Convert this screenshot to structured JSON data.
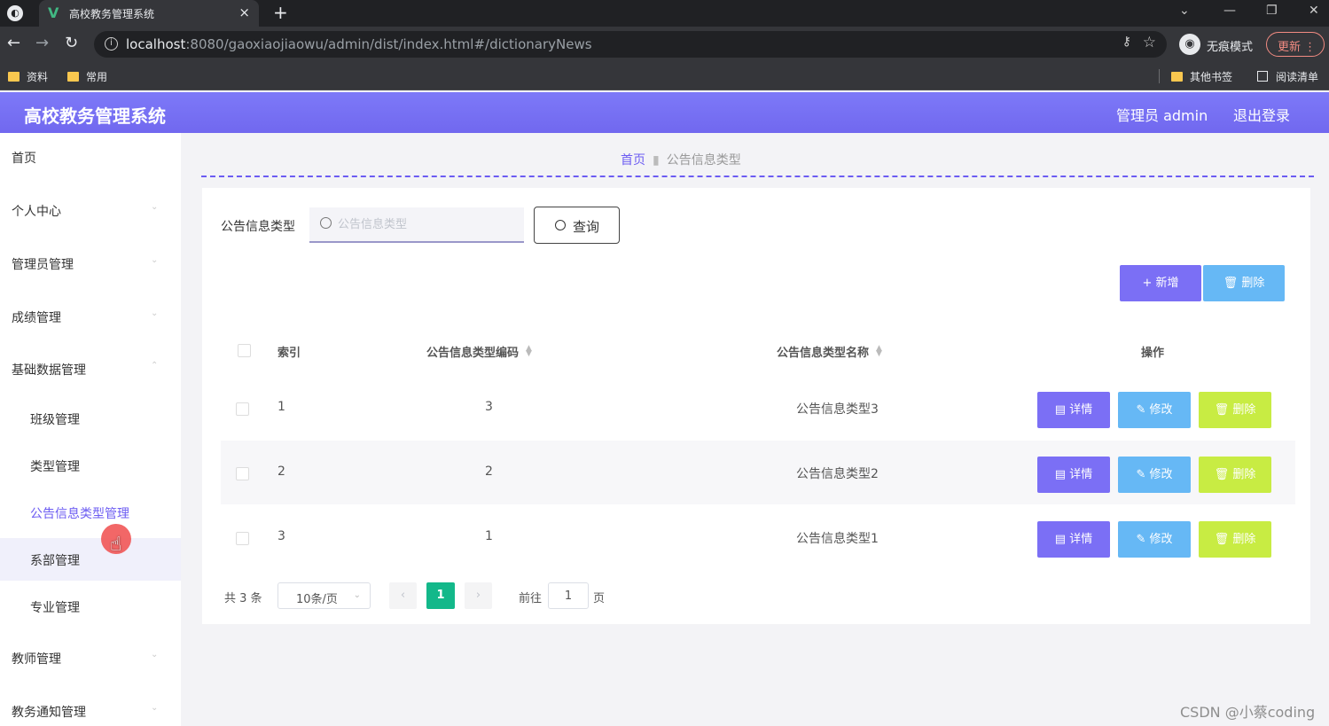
{
  "browser": {
    "tab_title": "高校教务管理系统",
    "tab_close": "×",
    "new_tab": "+",
    "url_host": "localhost",
    "url_rest": ":8080/gaoxiaojiaowu/admin/dist/index.html#/dictionaryNews",
    "incognito_label": "无痕模式",
    "update_label": "更新",
    "bookmarks": [
      "资料",
      "常用"
    ],
    "other_bookmarks": "其他书签",
    "reading_list": "阅读清单"
  },
  "header": {
    "title": "高校教务管理系统",
    "admin_text": "管理员 admin",
    "logout": "退出登录"
  },
  "sidebar": {
    "menus": [
      "首页",
      "个人中心",
      "管理员管理",
      "成绩管理",
      "基础数据管理"
    ],
    "submenus": [
      "班级管理",
      "类型管理",
      "公告信息类型管理",
      "系部管理",
      "专业管理"
    ],
    "menus_after": [
      "教师管理",
      "教务通知管理"
    ]
  },
  "breadcrumb": {
    "home": "首页",
    "current": "公告信息类型"
  },
  "search": {
    "label": "公告信息类型",
    "placeholder": "公告信息类型",
    "value": "",
    "query_button": "查询"
  },
  "actions": {
    "add": "+ 新增",
    "batch_delete": "删除"
  },
  "table": {
    "headers": {
      "index": "索引",
      "code": "公告信息类型编码",
      "name": "公告信息类型名称",
      "ops": "操作"
    },
    "rows": [
      {
        "index": "1",
        "code": "3",
        "name": "公告信息类型3"
      },
      {
        "index": "2",
        "code": "2",
        "name": "公告信息类型2"
      },
      {
        "index": "3",
        "code": "1",
        "name": "公告信息类型1"
      }
    ],
    "row_buttons": {
      "detail": "详情",
      "edit": "修改",
      "delete": "删除"
    }
  },
  "pagination": {
    "total": "共 3 条",
    "page_size": "10条/页",
    "current_page": "1",
    "goto_label": "前往",
    "goto_value": "1",
    "page_suffix": "页"
  },
  "watermark": "CSDN @小蔡coding",
  "colors": {
    "header": "#7168ef",
    "accent": "#6c5cf2",
    "btn_primary": "#7b6ff5",
    "btn_info": "#66b8f5",
    "btn_danger": "#c8ec43",
    "page_active": "#13b88a"
  }
}
